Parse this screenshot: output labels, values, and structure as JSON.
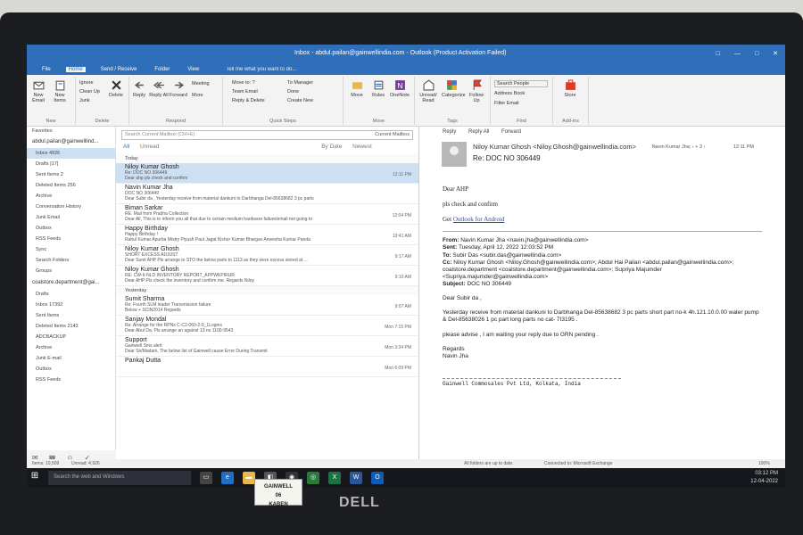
{
  "window": {
    "title": "Inbox - abdul.pailan@gainwellindia.com - Outlook (Product Activation Failed)",
    "controls": [
      "□",
      "—",
      "□",
      "✕"
    ]
  },
  "menubar": {
    "items": [
      "File",
      "Home",
      "Send / Receive",
      "Folder",
      "View"
    ],
    "active": "Home",
    "tell_me": "Tell me what you want to do..."
  },
  "ribbon": {
    "new_email": "New Email",
    "new_items": "New Items",
    "new_group": "New",
    "ignore": "Ignore",
    "cleanup": "Clean Up",
    "junk": "Junk",
    "delete": "Delete",
    "delete_group": "Delete",
    "reply": "Reply",
    "reply_all": "Reply All",
    "forward": "Forward",
    "meeting": "Meeting",
    "more": "More",
    "respond_group": "Respond",
    "quick_steps": [
      "Move to: ?",
      "Team Email",
      "Reply & Delete",
      "To Manager",
      "Done",
      "Create New"
    ],
    "quick_group": "Quick Steps",
    "move": "Move",
    "rules": "Rules",
    "onenote": "OneNote",
    "move_group": "Move",
    "unread_read": "Unread/ Read",
    "categorize": "Categorize",
    "follow_up": "Follow Up",
    "tags_group": "Tags",
    "search_people": "Search People",
    "address_book": "Address Book",
    "filter_email": "Filter Email",
    "find_group": "Find",
    "store": "Store",
    "addins_group": "Add-ins"
  },
  "nav": {
    "favorites": "Favorites",
    "account1": "abdul.pailan@gainwelllind...",
    "folders1": [
      {
        "label": "Inbox  4926",
        "selected": true
      },
      {
        "label": "Drafts [17]",
        "selected": false
      },
      {
        "label": "Sent Items  2",
        "selected": false
      },
      {
        "label": "Deleted Items  256",
        "selected": false
      },
      {
        "label": "Archive",
        "selected": false
      },
      {
        "label": "Conversation History",
        "selected": false
      },
      {
        "label": "Junk Email",
        "selected": false
      },
      {
        "label": "Outbox",
        "selected": false
      },
      {
        "label": "RSS Feeds",
        "selected": false
      },
      {
        "label": "Sync",
        "selected": false
      },
      {
        "label": "Search Folders",
        "selected": false
      },
      {
        "label": "Groups",
        "selected": false
      }
    ],
    "account2": "coalstore.department@gai...",
    "folders2": [
      "Drafts",
      "Inbox  17392",
      "Sent Items",
      "Deleted Items  2142",
      "ADCBACKUP",
      "Archive",
      "Junk E-mail",
      "Outbox",
      "RSS Feeds"
    ]
  },
  "list": {
    "search_placeholder": "Search Current Mailbox (Ctrl+E)",
    "scope": "Current Mailbox",
    "filter_all": "All",
    "filter_unread": "Unread",
    "sort_by": "By Date",
    "sort_order": "Newest",
    "group_today": "Today",
    "group_yesterday": "Yesterday",
    "messages": [
      {
        "sender": "Niloy Kumar Ghosh",
        "subject": "Re: DOC NO 306449",
        "preview": "Dear ahp  pls check and confirm",
        "time": "12:11 PM",
        "selected": true
      },
      {
        "sender": "Navin Kumar Jha",
        "subject": "DOC NO 306449",
        "preview": "Dear Subir da ,  Yesterday receive from material  dankuni to Darbhanga Del-85638682 3 pc parts",
        "time": "",
        "selected": false
      },
      {
        "sender": "Biman Sarkar",
        "subject": "RE: Mail from Prabha Collection",
        "preview": "Dear All,  This is to inform you all that due to certain medium hardware failure/email not going to",
        "time": "12:04 PM",
        "selected": false
      },
      {
        "sender": "Happy Birthday",
        "subject": "Happy Birthday !",
        "preview": "Rahul Kumar  Apurba Mistry  Piyush Paul  Jagat  Kishor Kumar  Bhargav  Anwesha  Kumar Panda",
        "time": "10:41 AM",
        "selected": false
      },
      {
        "sender": "Niloy Kumar Ghosh",
        "subject": "SHORT EXCESS ADJUST",
        "preview": "Dear Sunit AHP  Pls arrange to STO the below parts to 1113 as they were excess stored at ...",
        "time": "9:17 AM",
        "selected": false
      },
      {
        "sender": "Niloy Kumar Ghosh",
        "subject": "RE: CW-II-NLD INVENTORY REPORT_APPWKPIRUR",
        "preview": "Dear AHP  Pls check the inventory and confirm me.  Regards  Niloy",
        "time": "9:10 AM",
        "selected": false
      },
      {
        "sender": "Sumit Sharma",
        "subject": "Re: Fourth SLM leader Transmission failure",
        "preview": "Below + SCIN2014  Regards",
        "time": "9:07 AM",
        "selected": false
      },
      {
        "sender": "Sanjay Mondal",
        "subject": "Re: Arrange for the RPNs C-C2-060-2-0_1Logins",
        "preview": "Dear Abul Da,  Pls arrange an against 13 no 1100-9543",
        "time": "Mon 7:15 PM",
        "selected": false
      },
      {
        "sender": "Support",
        "subject": "Gainwell Sms alert",
        "preview": "Dear Sir/Madam,  The below list of Gainwell cause Error During Transmit",
        "time": "Mon 3:34 PM",
        "selected": false
      },
      {
        "sender": "Pankaj Dutta",
        "subject": "",
        "preview": "",
        "time": "Mon 6:09 PM",
        "selected": false
      }
    ]
  },
  "reading": {
    "reply": "Reply",
    "reply_all": "Reply All",
    "forward": "Forward",
    "from": "Niloy Kumar Ghosh <Niloy.Ghosh@gainwellindia.com>",
    "to_meta": "Navin Kumar Jha;  ‹ + 3 ›",
    "time": "12:11 PM",
    "subject": "Re: DOC NO 306449",
    "greeting": "Dear AHP",
    "line1": "pls check and confirm",
    "get_prefix": "Get ",
    "get_link": "Outlook for Android",
    "q_from_label": "From:",
    "q_from": " Navin Kumar Jha <navin.jha@gainwellindia.com>",
    "q_sent_label": "Sent:",
    "q_sent": " Tuesday, April 12, 2022 12:03:52 PM",
    "q_to_label": "To:",
    "q_to": " Subir Das <subir.das@gainwellindia.com>",
    "q_cc_label": "Cc:",
    "q_cc": " Niloy Kumar Ghosh <Niloy.Ghosh@gainwellindia.com>; Abdul Hai Pailan <abdul.pailan@gainwellindia.com>; coalstore.department <coalstore.department@gainwellindia.com>; Supriya Majumder <Supriya.majumder@gainwellindia.com>",
    "q_subject_label": "Subject:",
    "q_subject": " DOC NO 306449",
    "q_greet": "Dear Subir da ,",
    "q_body1": "Yesterday receive from material dankuni to Darbhanga Del-85638682 3 pc parts short part no-k 4h.121.10.0.00 water pump & Del-85638026 1 pc part long parts no cat- 7I3195 .",
    "q_body2": "please advise , I am waiting your reply due to GRN pending .",
    "q_regards": "Regards",
    "q_name": "Navin Jha",
    "signature": "Gainwell Commosales Pvt Ltd, Kolkata, India"
  },
  "status": {
    "items": "Items: 10,509",
    "unread": "Unread: 4,926",
    "sync": "All folders are up to date.",
    "conn": "Connected to: Microsoft Exchange",
    "zoom": "100%"
  },
  "taskbar": {
    "search": "Search the web and Windows",
    "time": "03:12 PM",
    "date": "12-04-2022",
    "lang": "ENG"
  },
  "sticker": {
    "line1": "GAINWELL",
    "line2": "06",
    "line3": "KABEN"
  },
  "brand": "DELL",
  "colors": {
    "accent": "#2f6fba",
    "selected": "#cde0f3"
  }
}
